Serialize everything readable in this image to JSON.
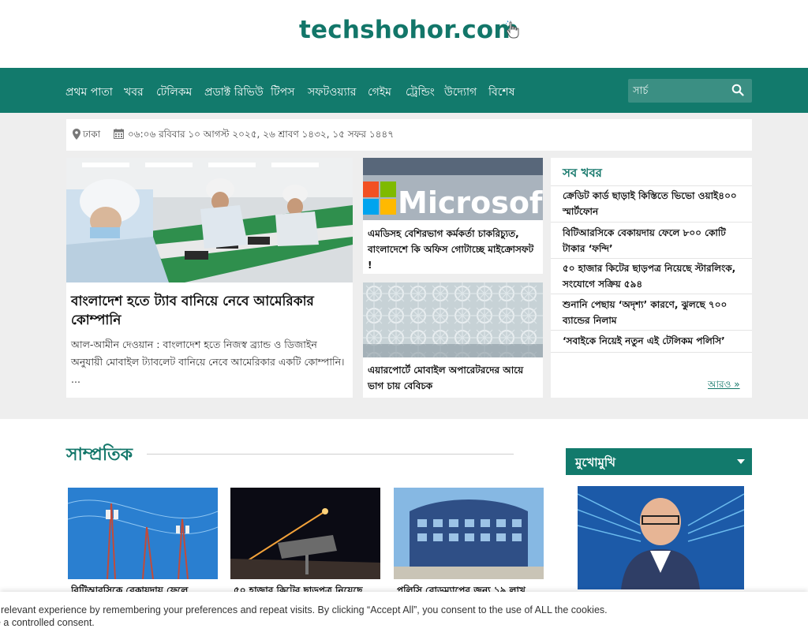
{
  "brand": {
    "logo_text": "techshohor.com"
  },
  "nav": {
    "items": [
      "প্রথম পাতা",
      "খবর",
      "টেলিকম",
      "প্রডাক্ট রিভিউ",
      "টিপস",
      "সফটওয়্যার",
      "গেইম",
      "ট্রেন্ডিং",
      "উদ্যোগ",
      "বিশেষ"
    ],
    "search_placeholder": "সার্চ"
  },
  "datebar": {
    "location": "ঢাকা",
    "datetime": "০৬:০৬ রবিবার ১০ আগস্ট ২০২৫, ২৬ শ্রাবণ ১৪৩২, ১৫ সফর ১৪৪৭"
  },
  "lead": {
    "title": "বাংলাদেশ হতে ট্যাব বানিয়ে নেবে আমেরিকার কোম্পানি",
    "excerpt": "আল-আমীন দেওয়ান : বাংলাদেশ হতে নিজস্ব ব্র্যান্ড ও ডিজাইন অনুযায়ী মোবাইল ট্যাবলেট বানিয়ে নেবে আমেরিকার একটি কোম্পানি। ..."
  },
  "mid_stories": [
    {
      "title": "এমডিসহ বেশিরভাগ কর্মকর্তা চাকরিচ্যুত, বাংলাদেশে কি অফিস গোটাচ্ছে মাইক্রোসফট !",
      "image_text": "Microsoft"
    },
    {
      "title": "এয়ারপোর্টে মোবাইল অপারেটরদের আয়ে ভাগ চায় বেবিচক"
    }
  ],
  "all_news": {
    "title": "সব খবর",
    "items": [
      "ক্রেডিট কার্ড ছাড়াই কিস্তিতে ভিভো ওয়াই৪০০ স্মার্টফোন",
      "বিটিআরসিকে বেকায়দায় ফেলে ৮০০ কোটি টাকার ‘ফন্দি’",
      "৫০ হাজার কিটের ছাড়পত্র নিয়েছে স্টারলিংক, সংযোগে সক্রিয় ৫৯৪",
      "শুনানি পেছায় ‘অদৃশ্য’ কারণে, ঝুলছে ৭০০ ব্যান্ডের নিলাম",
      "‘সবাইকে নিয়েই নতুন এই টেলিকম পলিসি’"
    ],
    "more_label": "আরও »"
  },
  "recent": {
    "title": "সাম্প্রতিক",
    "items": [
      {
        "title": "বিটিআরসিকে বেকায়দায় ফেলে"
      },
      {
        "title": "৫০ হাজার কিটের ছাড়পত্র নিয়েছে"
      },
      {
        "title": "পলিসি রোডম্যাপের জন্য ১৯ লাখ"
      }
    ]
  },
  "sidebar": {
    "title": "মুখোমুখি"
  },
  "cookie": {
    "line1": "t relevant experience by remembering your preferences and repeat visits. By clicking “Accept All”, you consent to the use of ALL the cookies.",
    "line2": "e a controlled consent."
  },
  "colors": {
    "brand": "#127669",
    "nav_bg": "#127a6c",
    "page_bg": "#eeeeee"
  }
}
